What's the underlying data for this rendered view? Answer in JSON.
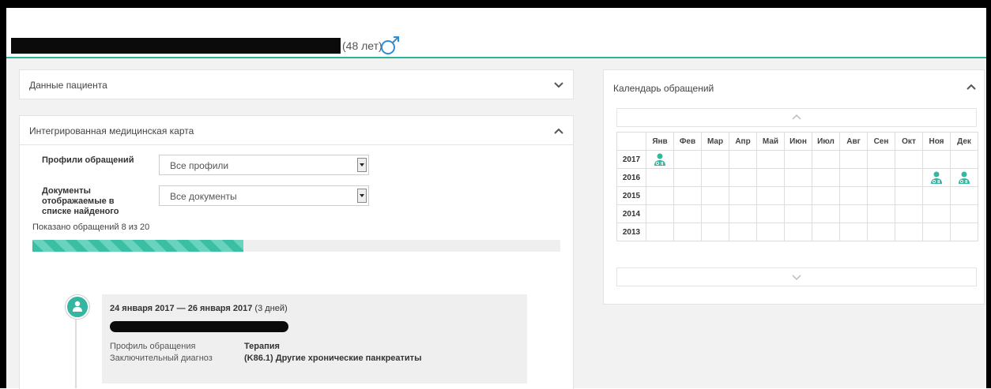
{
  "header": {
    "age": "(48 лет)",
    "gender_icon": "male-icon"
  },
  "patient_panel": {
    "title": "Данные пациента"
  },
  "record_panel": {
    "title": "Интегрированная медицинская карта",
    "profiles_label": "Профили обращений",
    "profiles_value": "Все профили",
    "docs_label": "Документы отображаемые в списке найденого",
    "docs_value": "Все документы",
    "shown_text": "Показано обращений 8 из 20",
    "progress_fraction": 0.4
  },
  "entry": {
    "date_bold": "24 января 2017 — 26 января 2017",
    "duration": "(3 дней)",
    "profile_label": "Профиль обращения",
    "profile_value": "Терапия",
    "diagnosis_label": "Заключительный диагноз",
    "diagnosis_value": "(K86.1) Другие хронические панкреатиты"
  },
  "calendar": {
    "title": "Календарь обращений",
    "months": [
      "Янв",
      "Фев",
      "Мар",
      "Апр",
      "Май",
      "Июн",
      "Июл",
      "Авг",
      "Сен",
      "Окт",
      "Ноя",
      "Дек"
    ],
    "years": [
      "2017",
      "2016",
      "2015",
      "2014",
      "2013"
    ],
    "visits": [
      {
        "year": "2017",
        "month": 0
      },
      {
        "year": "2016",
        "month": 10
      },
      {
        "year": "2016",
        "month": 11
      }
    ]
  },
  "colors": {
    "accent": "#35b6a0",
    "header_rule": "#2bb39a"
  }
}
